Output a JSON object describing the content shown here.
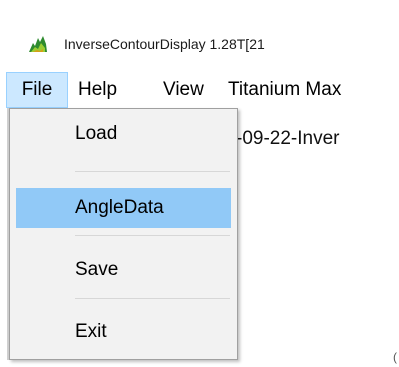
{
  "window": {
    "title": "InverseContourDisplay 1.28T[21"
  },
  "menubar": {
    "items": [
      "File",
      "Help",
      "View",
      "Titanium Max"
    ]
  },
  "file_menu": {
    "items": [
      "Load",
      "AngleData",
      "Save",
      "Exit"
    ],
    "highlighted": "AngleData"
  },
  "content": {
    "visible_text": "-09-22-Inver",
    "corner_text": "("
  },
  "colors": {
    "menu_highlight": "#91c9f7",
    "menubar_selected_bg": "#cce8ff",
    "icon_green": "#2e8b2e"
  },
  "icons": {
    "app_icon": "green-chart-icon"
  }
}
